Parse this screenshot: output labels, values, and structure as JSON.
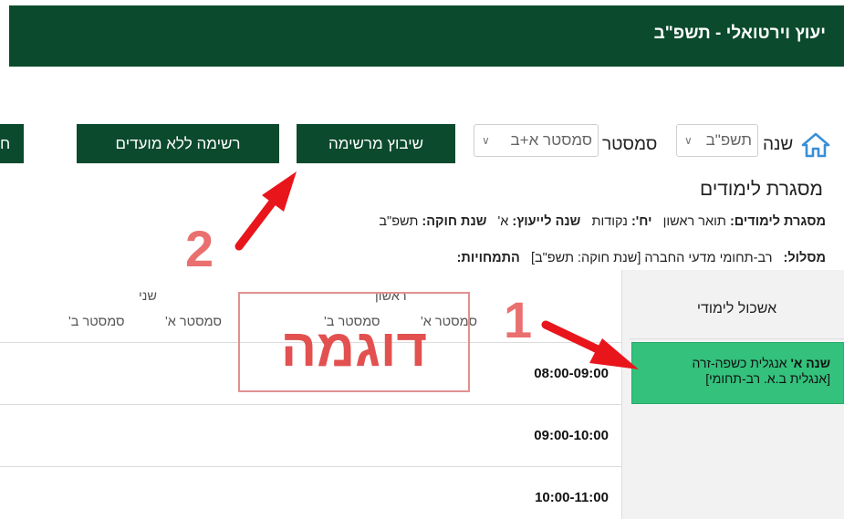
{
  "header": {
    "title": "יעוץ וירטואלי - תשפ\"ב"
  },
  "filters": {
    "year_label": "שנה",
    "year_value": "תשפ\"ב",
    "semester_label": "סמסטר",
    "semester_value": "סמסטר א+ב"
  },
  "buttons": {
    "schedule": "שיבוץ מרשימה",
    "list_no_dates": "רשימה ללא מועדים",
    "partial": "ח"
  },
  "framework": {
    "heading": "מסגרת לימודים",
    "line1": {
      "framework_key": "מסגרת לימודים:",
      "framework_val": "תואר ראשון",
      "credits_key": "יח':",
      "credits_val": "נקודות",
      "advise_key": "שנה לייעוץ:",
      "advise_val": "א'",
      "law_key": "שנת חוקה:",
      "law_val": "תשפ\"ב"
    },
    "line2": {
      "track_key": "מסלול:",
      "track_val": "רב-תחומי מדעי החברה [שנת חוקה: תשפ\"ב]",
      "spec_key": "התמחויות:"
    }
  },
  "sidebar": {
    "header": "אשכול לימודי",
    "course_year": "שנה א'",
    "course_name": "אנגלית כשפה-זרה",
    "course_sub": "[אנגלית ב.א. רב-תחומי]"
  },
  "grid": {
    "days": [
      "ראשון",
      "שני"
    ],
    "semesters": [
      "סמסטר א'",
      "סמסטר ב'",
      "סמסטר א'",
      "סמסטר ב'"
    ],
    "times": [
      "08:00-09:00",
      "09:00-10:00",
      "10:00-11:00"
    ]
  },
  "overlay": {
    "sample": "דוגמה",
    "num1": "1",
    "num2": "2",
    "arrow_color": "#e8151b"
  },
  "colors": {
    "brand": "#0b4a2c",
    "course": "#33c17c",
    "accent_icon": "#3a8fd6"
  }
}
